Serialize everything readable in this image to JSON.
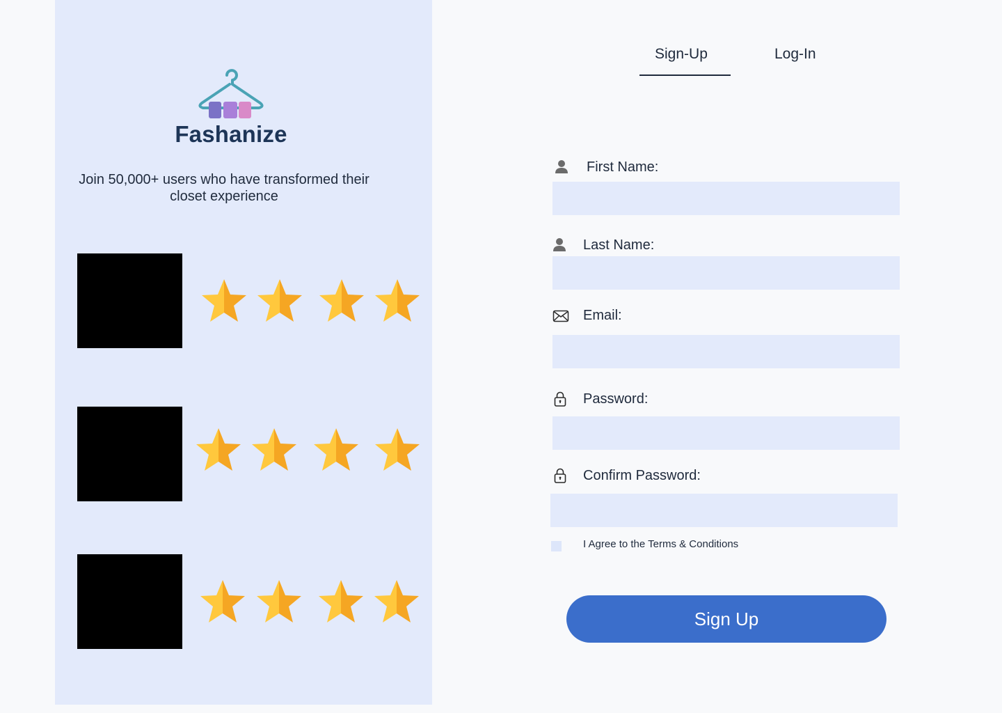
{
  "brand": {
    "name": "Fashanize",
    "logo_icon": "hanger-icon",
    "colors": {
      "hanger": "#4aa3b5",
      "block1": "#7b72c6",
      "block2": "#a97fd9",
      "block3": "#d98ac8",
      "text": "#1d3557"
    }
  },
  "tagline": "Join 50,000+ users who have transformed their closet experience",
  "reviews": [
    {
      "rating": 4,
      "max_visible": 4
    },
    {
      "rating": 4,
      "max_visible": 4
    },
    {
      "rating": 4,
      "max_visible": 4
    }
  ],
  "tabs": [
    {
      "label": "Sign-Up",
      "active": true
    },
    {
      "label": "Log-In",
      "active": false
    }
  ],
  "form": {
    "fields": [
      {
        "label": "First Name:",
        "icon": "user-icon",
        "value": ""
      },
      {
        "label": "Last Name:",
        "icon": "user-icon",
        "value": ""
      },
      {
        "label": "Email:",
        "icon": "envelope-icon",
        "value": ""
      },
      {
        "label": "Password:",
        "icon": "lock-icon",
        "value": ""
      },
      {
        "label": "Confirm Password:",
        "icon": "lock-icon",
        "value": ""
      }
    ],
    "terms_label": "I Agree to the Terms & Conditions",
    "terms_checked": false,
    "submit_label": "Sign Up"
  },
  "colors": {
    "panel_bg": "#e3eafb",
    "page_bg": "#f8f9fb",
    "input_bg": "#e3eafb",
    "button": "#3b6ecb",
    "star_light": "#ffc83d",
    "star_dark": "#f5a623"
  }
}
